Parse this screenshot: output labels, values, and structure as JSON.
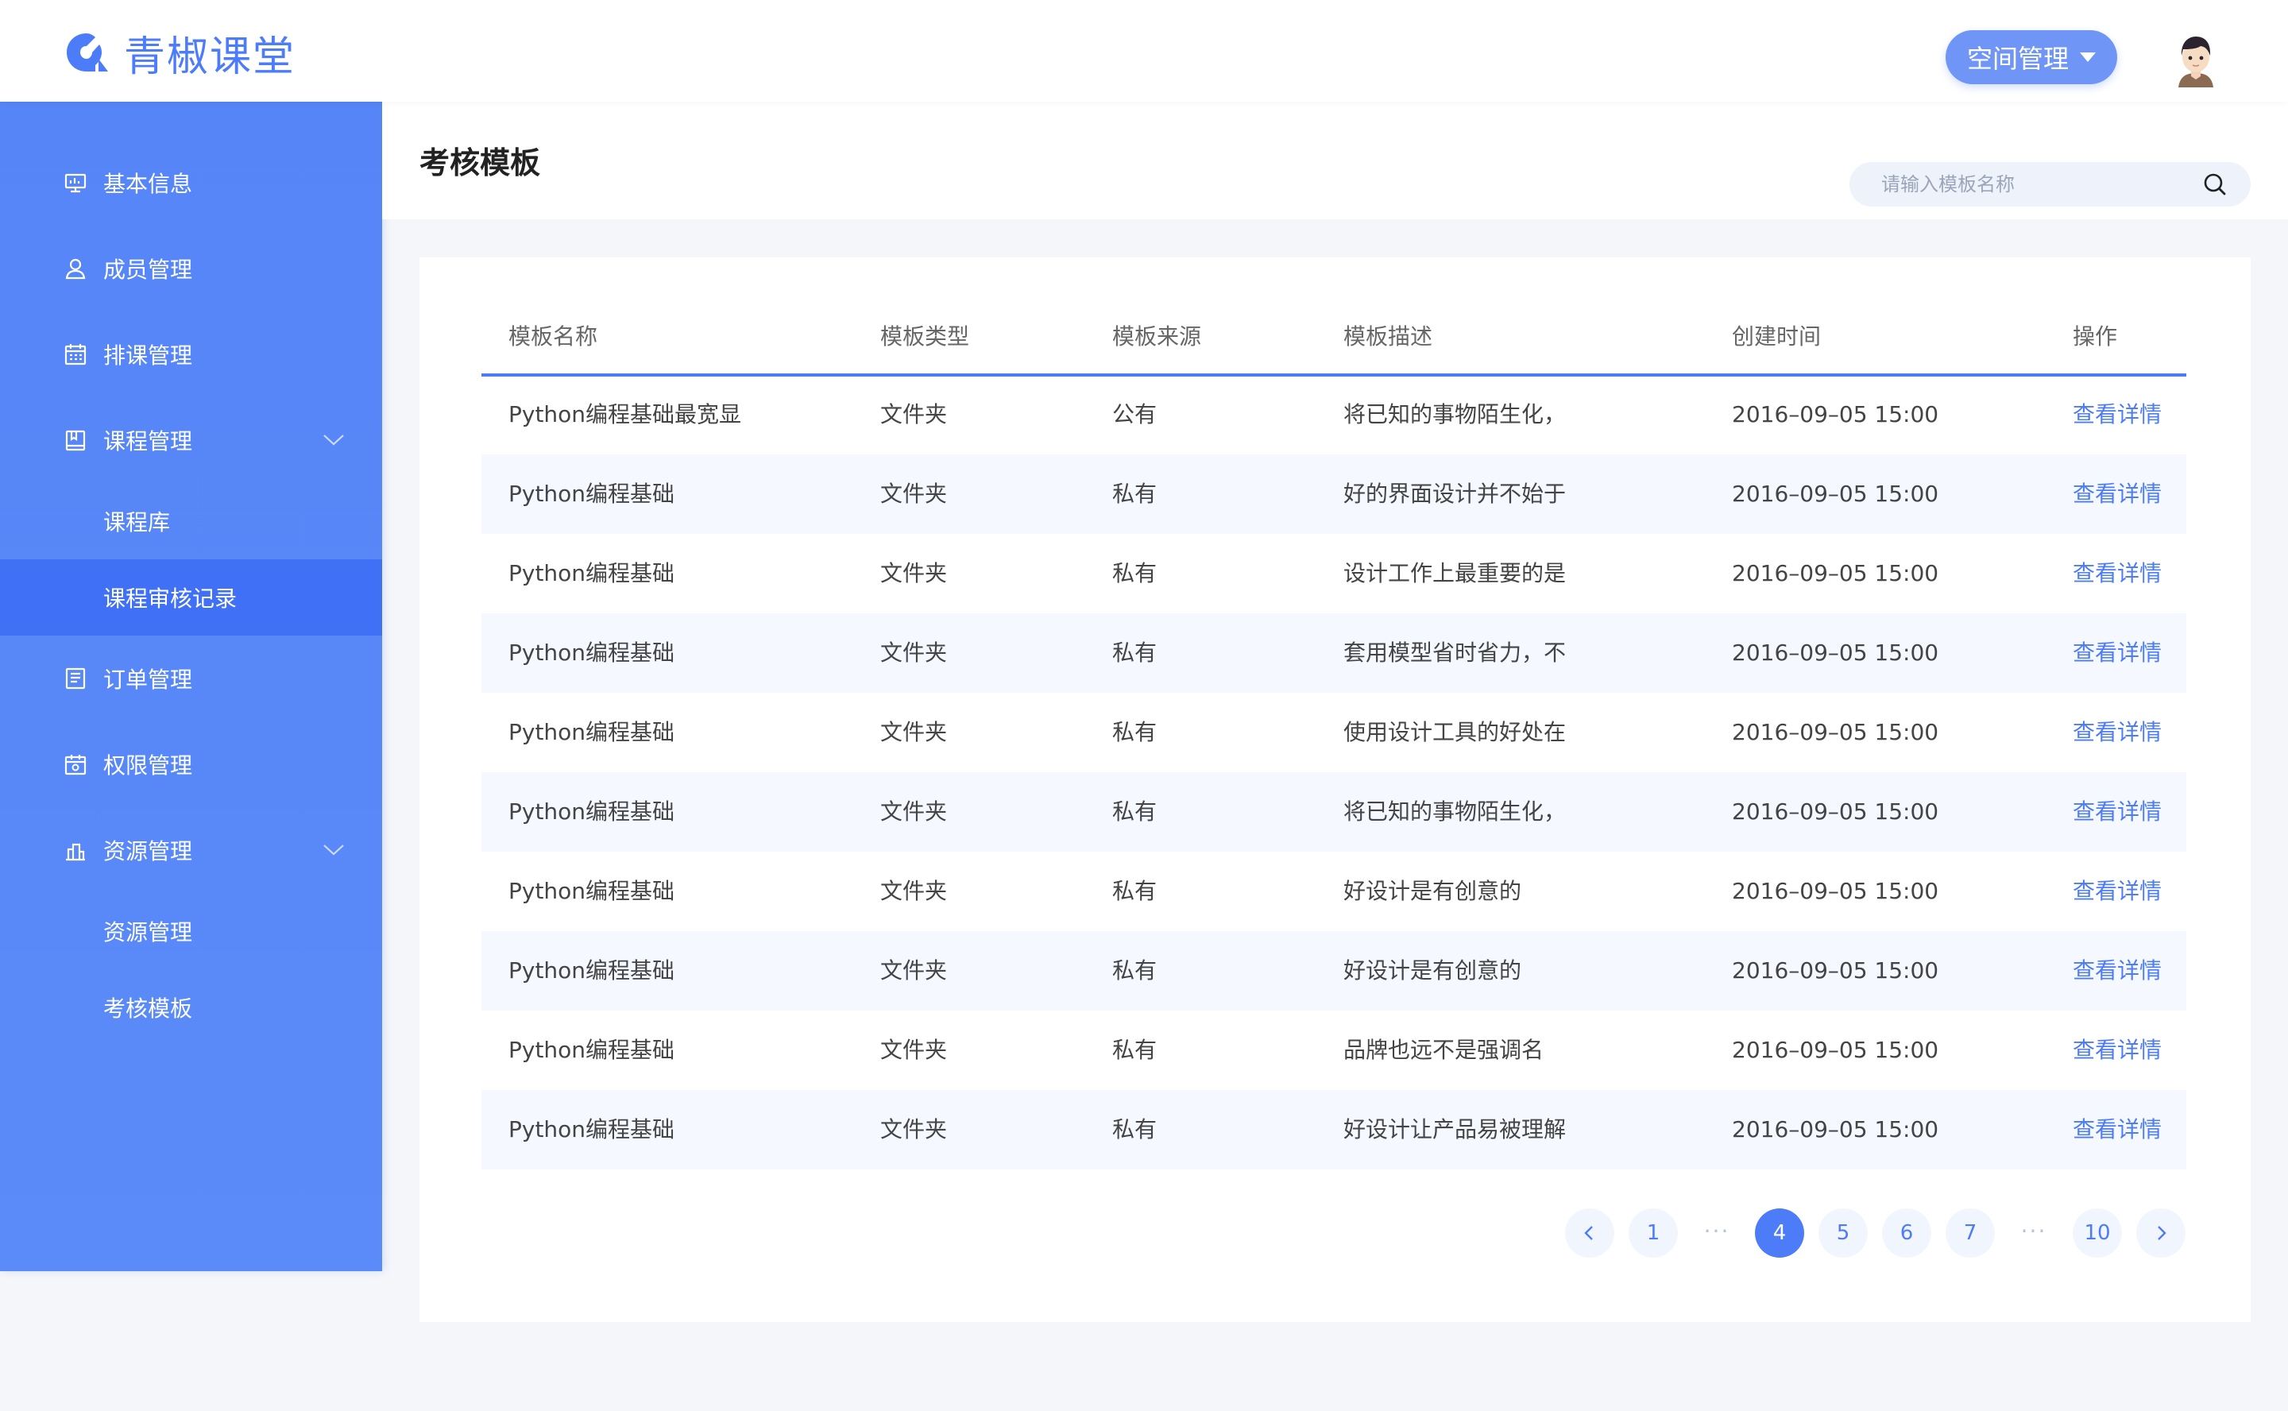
{
  "app": {
    "name": "青椒课堂"
  },
  "header": {
    "space_button": "空间管理"
  },
  "sidebar": {
    "items": [
      {
        "label": "基本信息",
        "icon": "monitor-icon"
      },
      {
        "label": "成员管理",
        "icon": "user-icon"
      },
      {
        "label": "排课管理",
        "icon": "calendar-icon"
      },
      {
        "label": "课程管理",
        "icon": "book-icon"
      },
      {
        "label": "课程库"
      },
      {
        "label": "课程审核记录"
      },
      {
        "label": "订单管理",
        "icon": "order-icon"
      },
      {
        "label": "权限管理",
        "icon": "permission-icon"
      },
      {
        "label": "资源管理",
        "icon": "resource-icon"
      },
      {
        "label": "资源管理"
      },
      {
        "label": "考核模板"
      }
    ]
  },
  "page": {
    "title": "考核模板",
    "search_placeholder": "请输入模板名称"
  },
  "table": {
    "headers": [
      "模板名称",
      "模板类型",
      "模板来源",
      "模板描述",
      "创建时间",
      "操作"
    ],
    "rows": [
      {
        "name": "Python编程基础最宽显",
        "type": "文件夹",
        "source": "公有",
        "desc": "将已知的事物陌生化，",
        "time": "2016–09–05 15:00",
        "action": "查看详情"
      },
      {
        "name": "Python编程基础",
        "type": "文件夹",
        "source": "私有",
        "desc": "好的界面设计并不始于",
        "time": "2016–09–05 15:00",
        "action": "查看详情"
      },
      {
        "name": "Python编程基础",
        "type": "文件夹",
        "source": "私有",
        "desc": "设计工作上最重要的是",
        "time": "2016–09–05 15:00",
        "action": "查看详情"
      },
      {
        "name": "Python编程基础",
        "type": "文件夹",
        "source": "私有",
        "desc": "套用模型省时省力，不",
        "time": "2016–09–05 15:00",
        "action": "查看详情"
      },
      {
        "name": "Python编程基础",
        "type": "文件夹",
        "source": "私有",
        "desc": "使用设计工具的好处在",
        "time": "2016–09–05 15:00",
        "action": "查看详情"
      },
      {
        "name": "Python编程基础",
        "type": "文件夹",
        "source": "私有",
        "desc": "将已知的事物陌生化，",
        "time": "2016–09–05 15:00",
        "action": "查看详情"
      },
      {
        "name": "Python编程基础",
        "type": "文件夹",
        "source": "私有",
        "desc": "好设计是有创意的",
        "time": "2016–09–05 15:00",
        "action": "查看详情"
      },
      {
        "name": "Python编程基础",
        "type": "文件夹",
        "source": "私有",
        "desc": "好设计是有创意的",
        "time": "2016–09–05 15:00",
        "action": "查看详情"
      },
      {
        "name": "Python编程基础",
        "type": "文件夹",
        "source": "私有",
        "desc": "品牌也远不是强调名",
        "time": "2016–09–05 15:00",
        "action": "查看详情"
      },
      {
        "name": "Python编程基础",
        "type": "文件夹",
        "source": "私有",
        "desc": "好设计让产品易被理解",
        "time": "2016–09–05 15:00",
        "action": "查看详情"
      }
    ]
  },
  "pagination": {
    "pages": [
      "1",
      "4",
      "5",
      "6",
      "7",
      "10"
    ],
    "ellipsis": "···",
    "current": "4"
  },
  "colors": {
    "accent": "#4d7cf8",
    "sidebar": "#5585f7",
    "active_item": "#3f70f5"
  }
}
